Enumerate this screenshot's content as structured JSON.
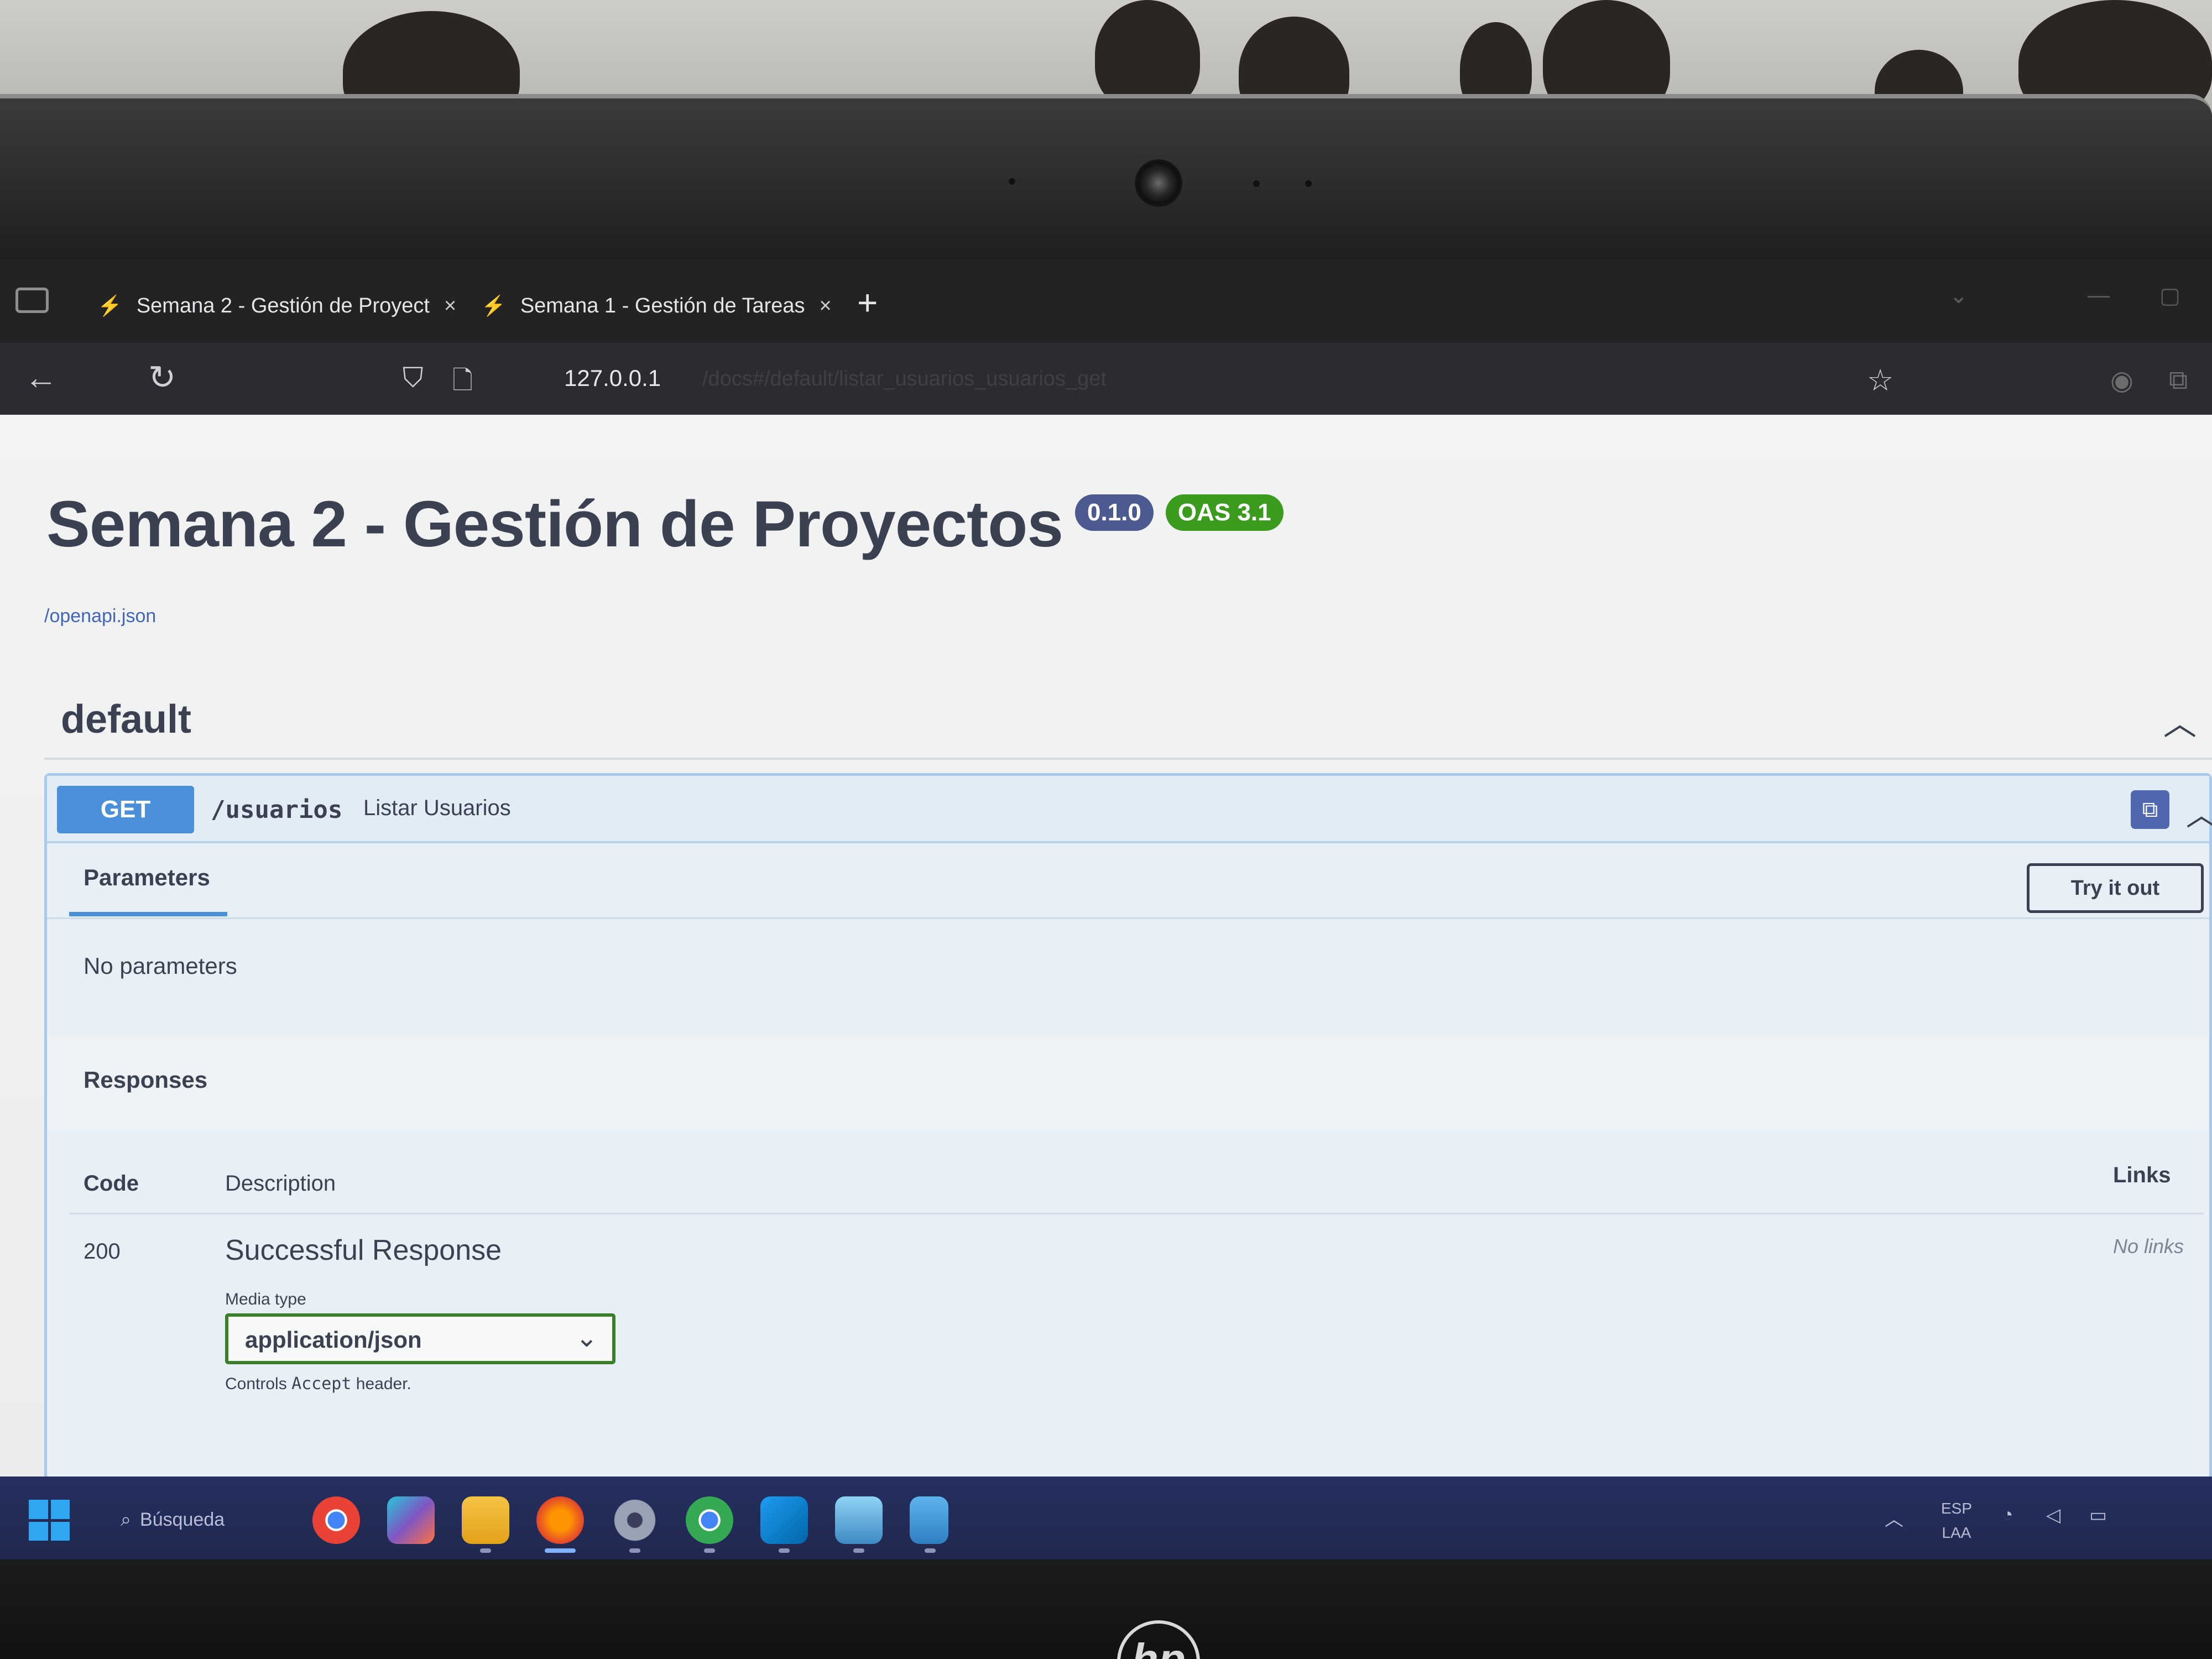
{
  "browser": {
    "tabs": [
      {
        "label": "Semana 2 - Gestión de Proyect",
        "active": true
      },
      {
        "label": "Semana 1 - Gestión de Tareas",
        "active": false
      }
    ],
    "new_tab_label": "+",
    "tab_close_label": "×",
    "address": "127.0.0.1",
    "address_rest": "/docs#/default/listar_usuarios_usuarios_get"
  },
  "page": {
    "title": "Semana 2 - Gestión de Proyectos",
    "version_badge": "0.1.0",
    "oas_badge": "OAS 3.1",
    "spec_link": "/openapi.json"
  },
  "section": {
    "name": "default"
  },
  "operation": {
    "method": "GET",
    "path": "/usuarios",
    "summary": "Listar Usuarios",
    "parameters_tab": "Parameters",
    "try_button": "Try it out",
    "no_parameters": "No parameters",
    "responses_title": "Responses",
    "columns": {
      "code": "Code",
      "description": "Description",
      "links": "Links"
    },
    "responses": [
      {
        "code": "200",
        "description": "Successful Response",
        "links": "No links"
      }
    ],
    "media_type_label": "Media type",
    "media_type_value": "application/json",
    "controls_note_prefix": "Controls",
    "controls_note_mono": "Accept",
    "controls_note_suffix": "header."
  },
  "taskbar": {
    "search_label": "Búsqueda",
    "lang_top": "ESP",
    "lang_bottom": "LAA"
  },
  "colors": {
    "get_method": "#4a90d9",
    "version_badge": "#4d5a8f",
    "oas_badge": "#3a9b1e",
    "text_primary": "#3b4151",
    "taskbar": "#253060"
  },
  "icons": {
    "back": "arrow-left-icon",
    "reload": "reload-icon",
    "shield": "shield-icon",
    "page": "page-icon",
    "bookmark": "star-icon",
    "copy": "copy-icon",
    "collapse": "chevron-up-icon",
    "select": "chevron-down-icon"
  }
}
